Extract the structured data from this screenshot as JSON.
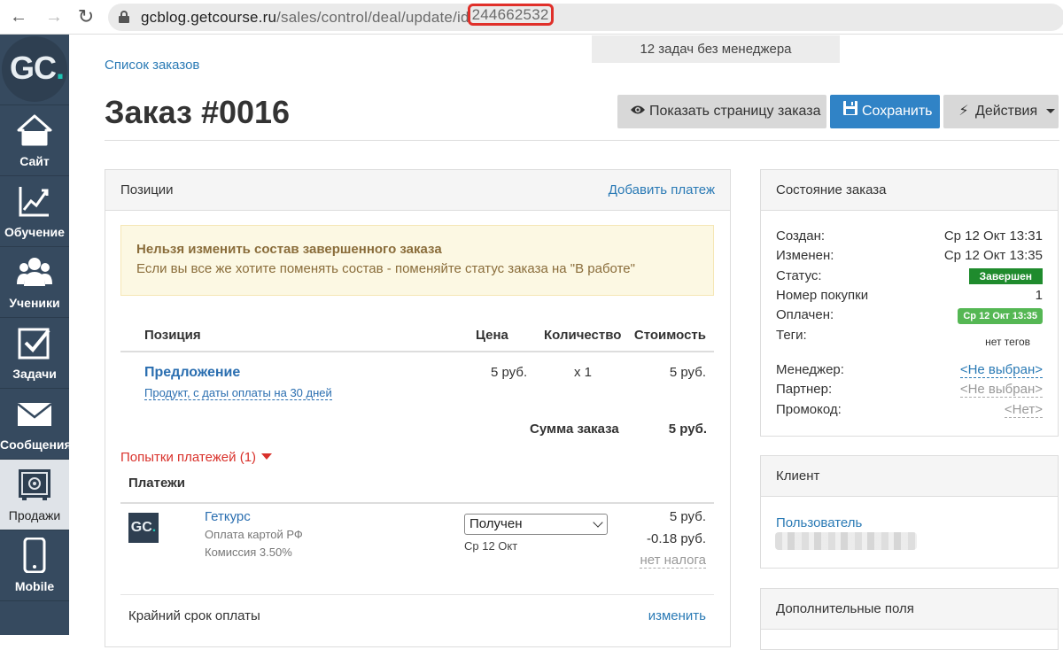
{
  "browser": {
    "url_host": "gcblog.getcourse.ru",
    "url_path": "/sales/control/deal/update/id",
    "url_id": "244662532",
    "back_icon": "arrow-left-icon",
    "forward_icon": "arrow-right-icon",
    "reload_icon": "reload-icon"
  },
  "sidebar": {
    "logo_text": "GC",
    "logo_dot": ".",
    "items": [
      {
        "label": "Сайт",
        "icon": "house-icon"
      },
      {
        "label": "Обучение",
        "icon": "chart-icon"
      },
      {
        "label": "Ученики",
        "icon": "users-icon"
      },
      {
        "label": "Задачи",
        "icon": "checkbox-icon"
      },
      {
        "label": "Сообщения",
        "icon": "envelope-icon"
      },
      {
        "label": "Продажи",
        "icon": "safe-icon"
      },
      {
        "label": "Mobile",
        "icon": "phone-icon"
      }
    ]
  },
  "header": {
    "tasks_notice": "12 задач без менеджера",
    "breadcrumb": "Список заказов",
    "title": "Заказ #0016",
    "btn_show": "Показать страницу заказа",
    "btn_save": "Сохранить",
    "btn_actions": "Действия"
  },
  "positions": {
    "panel_title": "Позиции",
    "add_payment": "Добавить платеж",
    "warn_title": "Нельзя изменить состав завершенного заказа",
    "warn_text": "Если вы все же хотите поменять состав - поменяйте статус заказа на \"В работе\"",
    "columns": {
      "position": "Позиция",
      "price": "Цена",
      "qty": "Количество",
      "cost": "Стоимость"
    },
    "row": {
      "name": "Предложение",
      "sub": "Продукт, с даты оплаты на 30 дней",
      "price": "5 руб.",
      "qty": "x 1",
      "cost": "5 руб."
    },
    "sum_label": "Сумма заказа",
    "sum_value": "5 руб."
  },
  "payments": {
    "attempts": "Попытки платежей (1)",
    "title": "Платежи",
    "item": {
      "logo": "GC",
      "logo_dot": ".",
      "name": "Геткурс",
      "method": "Оплата картой РФ",
      "commission": "Комиссия 3.50%",
      "status": "Получен",
      "date": "Ср 12 Окт",
      "amount": "5 руб.",
      "fee": "-0.18 руб.",
      "tax": "нет налога"
    },
    "deadline_label": "Крайний срок оплаты",
    "deadline_action": "изменить"
  },
  "status_panel": {
    "title": "Состояние заказа",
    "created_label": "Создан:",
    "created_value": "Ср 12 Окт 13:31",
    "changed_label": "Изменен:",
    "changed_value": "Ср 12 Окт 13:35",
    "status_label": "Статус:",
    "status_value": "Завершен",
    "purchase_label": "Номер покупки",
    "purchase_value": "1",
    "paid_label": "Оплачен:",
    "paid_value": "Ср 12 Окт 13:35",
    "tags_label": "Теги:",
    "tags_value": "нет тегов",
    "manager_label": "Менеджер:",
    "manager_value": "<Не выбран>",
    "partner_label": "Партнер:",
    "partner_value": "<Не выбран>",
    "promo_label": "Промокод:",
    "promo_value": "<Нет>"
  },
  "client_panel": {
    "title": "Клиент",
    "user": "Пользователь"
  },
  "extra_panel": {
    "title": "Дополнительные поля"
  },
  "colors": {
    "accent": "#3083c6",
    "sidebar": "#364a5f",
    "status_green": "#1f8b2d",
    "highlight_red": "#e0302a"
  }
}
